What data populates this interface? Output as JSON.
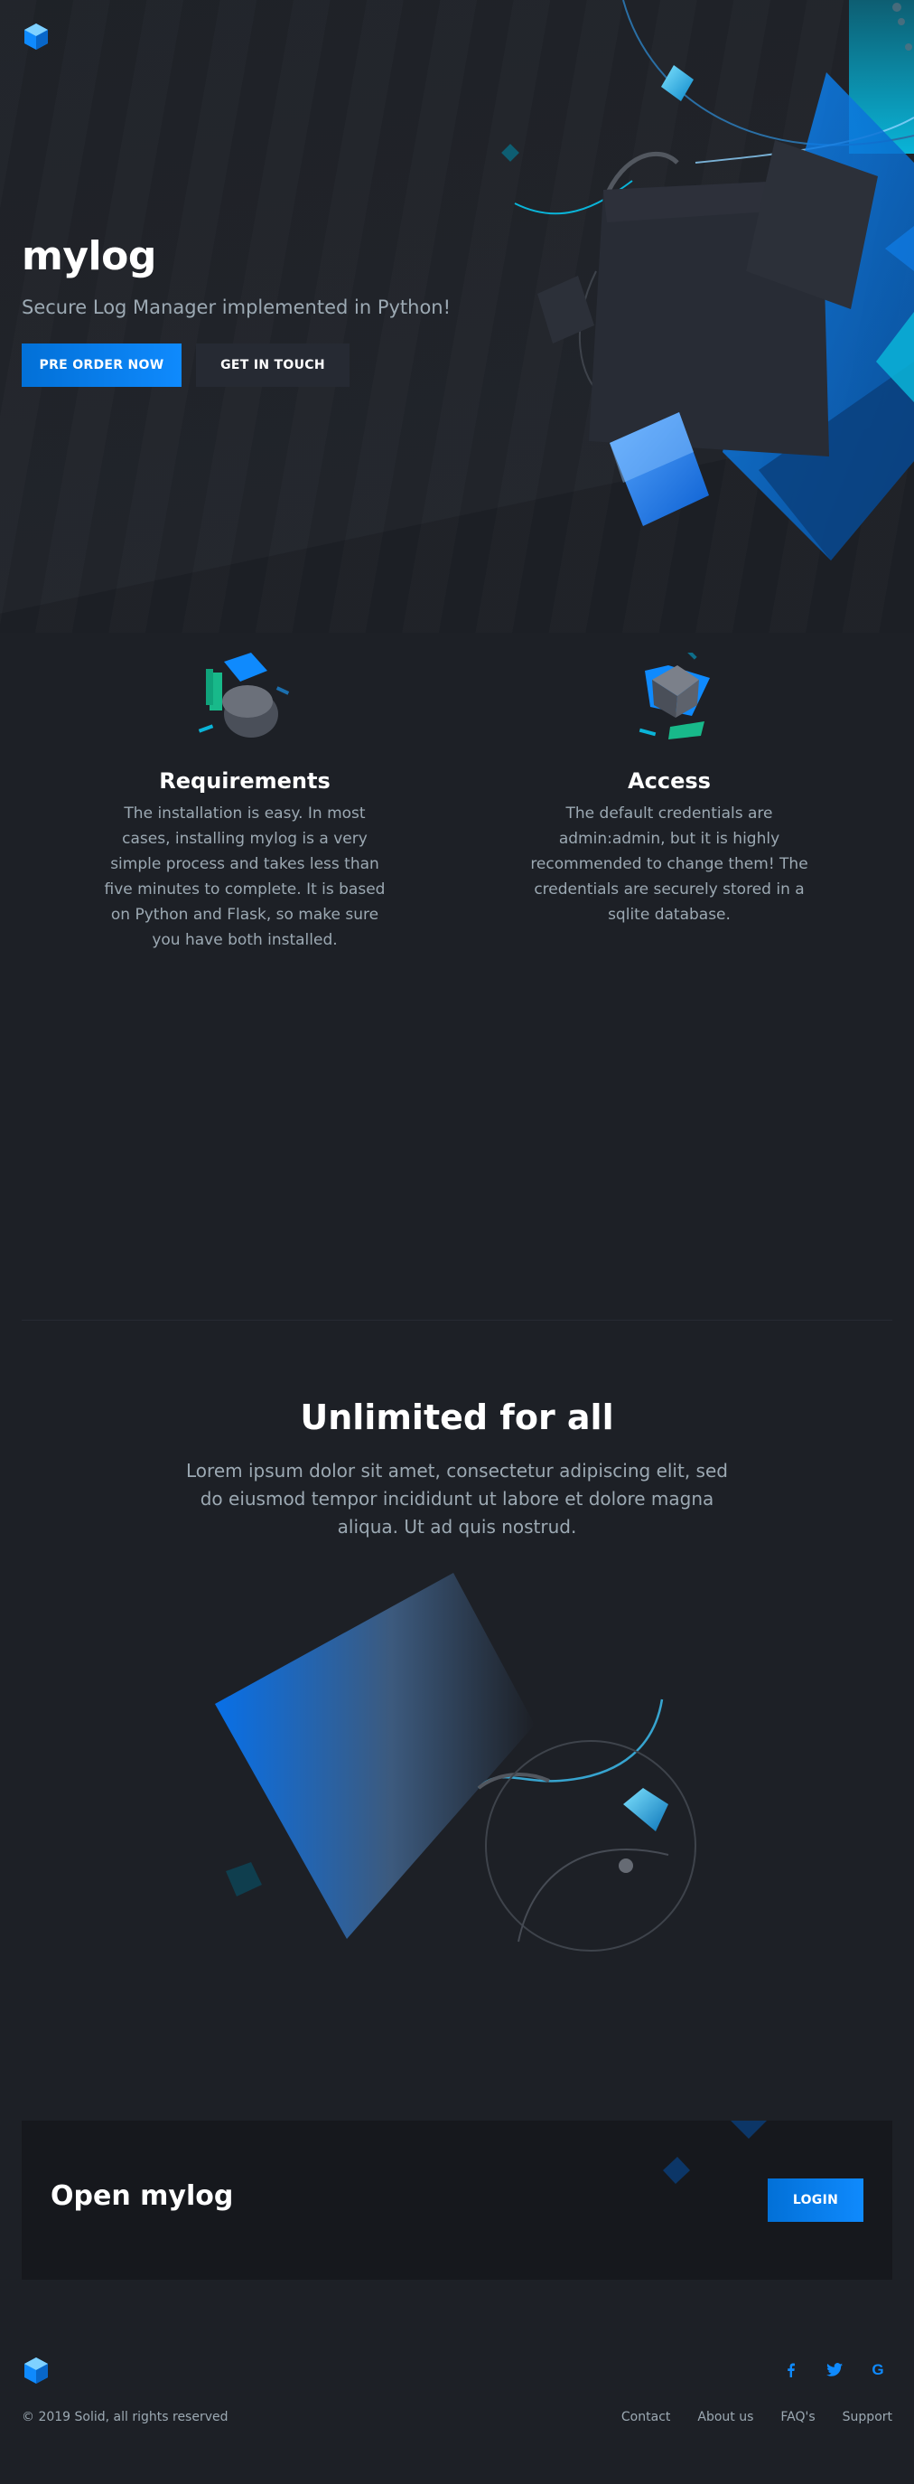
{
  "hero": {
    "title": "mylog",
    "subtitle": "Secure Log Manager implemented in Python!",
    "primary_button": "PRE ORDER NOW",
    "secondary_button": "GET IN TOUCH"
  },
  "features": [
    {
      "title": "Requirements",
      "text": "The installation is easy. In most cases, installing mylog is a very simple process and takes less than five minutes to complete. It is based on Python and Flask, so make sure you have both installed.",
      "icon": "cylinder-blocks-icon"
    },
    {
      "title": "Access",
      "text": "The default credentials are admin:admin, but it is highly recommended to change them! The credentials are securely stored in a sqlite database.",
      "icon": "cube-key-icon"
    }
  ],
  "pricing": {
    "title": "Unlimited for all",
    "text": "Lorem ipsum dolor sit amet, consectetur adipiscing elit, sed do eiusmod tempor incididunt ut labore et dolore magna aliqua. Ut ad quis nostrud."
  },
  "cta": {
    "title": "Open mylog",
    "button": "LOGIN"
  },
  "footer": {
    "copyright": "© 2019 Solid, all rights reserved",
    "links": [
      "Contact",
      "About us",
      "FAQ's",
      "Support"
    ],
    "social_icons": [
      "facebook-icon",
      "twitter-icon",
      "google-icon"
    ]
  },
  "colors": {
    "background": "#1d2026",
    "accent": "#0f8afd",
    "text_muted": "#9ca9b3"
  }
}
